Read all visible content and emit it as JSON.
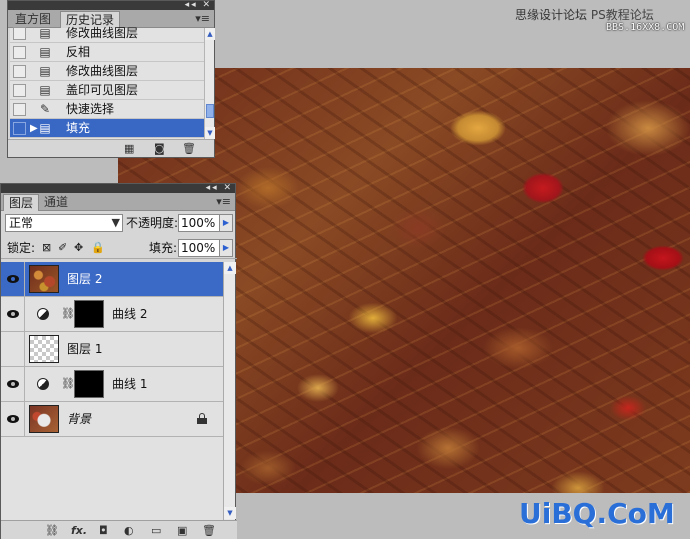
{
  "credit": {
    "site": "思缘设计论坛",
    "brand": "PS教程论坛",
    "url": "BBS.16XX8.COM"
  },
  "watermark": "UiBQ.CoM",
  "history": {
    "tabs": [
      {
        "label": "直方图"
      },
      {
        "label": "历史记录"
      }
    ],
    "menu_icon": "≡",
    "items": [
      {
        "label": "修改曲线图层",
        "icon": "document-icon"
      },
      {
        "label": "反相",
        "icon": "document-icon"
      },
      {
        "label": "修改曲线图层",
        "icon": "document-icon"
      },
      {
        "label": "盖印可见图层",
        "icon": "document-icon"
      },
      {
        "label": "快速选择",
        "icon": "quick-select-icon"
      },
      {
        "label": "填充",
        "icon": "document-icon",
        "selected": true
      }
    ]
  },
  "layers": {
    "tabs": [
      {
        "label": "图层"
      },
      {
        "label": "通道"
      }
    ],
    "blend_mode": "正常",
    "opacity_label": "不透明度:",
    "opacity_value": "100%",
    "lock_label": "锁定:",
    "fill_label": "填充:",
    "fill_value": "100%",
    "rows": [
      {
        "name": "图层 2",
        "kind": "pixel",
        "selected": true
      },
      {
        "name": "曲线 2",
        "kind": "adjustment"
      },
      {
        "name": "图层 1",
        "kind": "transparent"
      },
      {
        "name": "曲线 1",
        "kind": "adjustment"
      },
      {
        "name": "背景",
        "kind": "background",
        "locked": true
      }
    ]
  },
  "colors": {
    "selection": "#3b69c6",
    "panel_bg": "#d6d6d6",
    "watermark": "#2a6fd8"
  }
}
